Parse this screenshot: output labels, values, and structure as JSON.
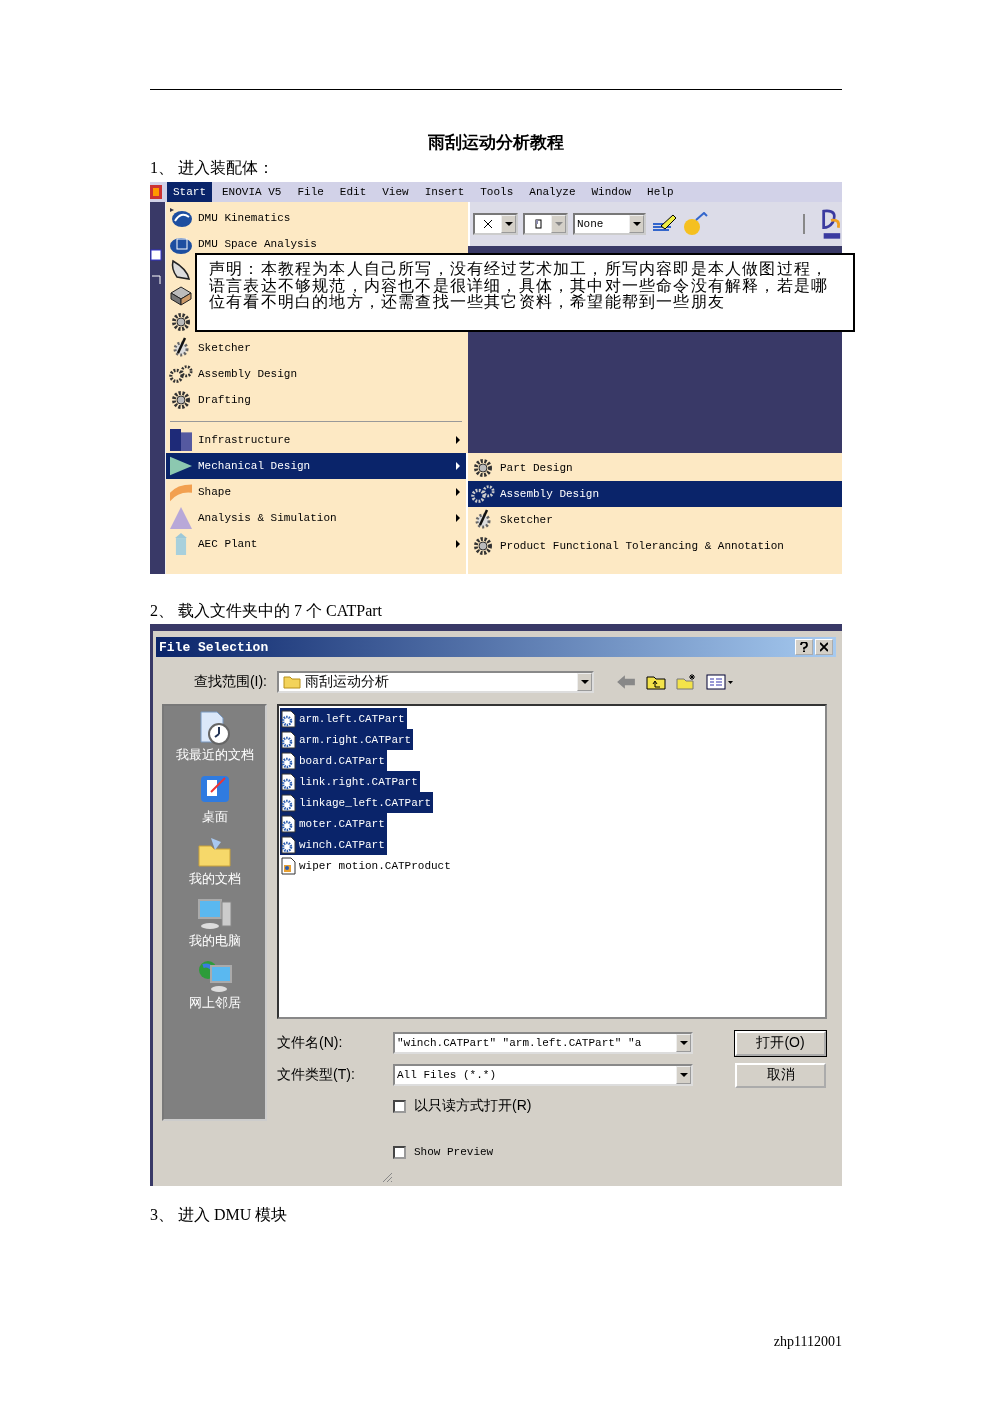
{
  "doc_title": "雨刮运动分析教程",
  "step_1": "1、 进入装配体：",
  "catia_screenshot": {
    "menu_bar": [
      {
        "label": "Start",
        "selected": true
      },
      {
        "label": "ENOVIA V5",
        "selected": false
      },
      {
        "label": "File",
        "selected": false
      },
      {
        "label": "Edit",
        "selected": false
      },
      {
        "label": "View",
        "selected": false
      },
      {
        "label": "Insert",
        "selected": false
      },
      {
        "label": "Tools",
        "selected": false
      },
      {
        "label": "Analyze",
        "selected": false
      },
      {
        "label": "Window",
        "selected": false
      },
      {
        "label": "Help",
        "selected": false
      }
    ],
    "toolbar": {
      "style_combo": "None"
    },
    "workbenches": [
      {
        "label": "DMU Kinematics",
        "selected": false
      },
      {
        "label": "DMU Space Analysis",
        "selected": false
      },
      {
        "selected": false
      },
      {
        "selected": false
      },
      {
        "selected": false
      },
      {
        "label": "Sketcher",
        "selected": false
      },
      {
        "label": "Assembly Design",
        "selected": false
      },
      {
        "label": "Drafting",
        "selected": false
      }
    ],
    "categories": [
      {
        "label": "Infrastructure",
        "selected": false,
        "submenu": true
      },
      {
        "label": "Mechanical Design",
        "selected": true,
        "submenu": true
      },
      {
        "label": "Shape",
        "selected": false,
        "submenu": true
      },
      {
        "label": "Analysis & Simulation",
        "selected": false,
        "submenu": true
      },
      {
        "label": "AEC Plant",
        "selected": false,
        "submenu": true
      }
    ],
    "submenu": [
      {
        "label": "Part Design",
        "selected": false
      },
      {
        "label": "Assembly Design",
        "selected": true
      },
      {
        "label": "Sketcher",
        "selected": false
      },
      {
        "label": "Product Functional Tolerancing & Annotation",
        "selected": false
      }
    ],
    "notice": "声明：本教程为本人自己所写，没有经过艺术加工，所写内容即是本人做图过程，语言表达不够规范，内容也不是很详细，具体，其中对一些命令没有解释，若是哪位有看不明白的地方，还需查找一些其它资料，希望能帮到一些朋友"
  },
  "step_2": "2、 载入文件夹中的 7 个 CATPart",
  "file_dialog": {
    "title": "File Selection",
    "look_in_label": "查找范围(I):",
    "look_in_value": "雨刮运动分析",
    "places": [
      "我最近的文档",
      "桌面",
      "我的文档",
      "我的电脑",
      "网上邻居"
    ],
    "files": [
      {
        "name": "arm.left.CATPart",
        "selected": true,
        "kind": "part"
      },
      {
        "name": "arm.right.CATPart",
        "selected": true,
        "kind": "part"
      },
      {
        "name": "board.CATPart",
        "selected": true,
        "kind": "part"
      },
      {
        "name": "link.right.CATPart",
        "selected": true,
        "kind": "part"
      },
      {
        "name": "linkage_left.CATPart",
        "selected": true,
        "kind": "part"
      },
      {
        "name": "moter.CATPart",
        "selected": true,
        "kind": "part"
      },
      {
        "name": "winch.CATPart",
        "selected": true,
        "kind": "part"
      },
      {
        "name": "wiper motion.CATProduct",
        "selected": false,
        "kind": "product"
      }
    ],
    "file_name_label": "文件名(N):",
    "file_name_value": "\"winch.CATPart\" \"arm.left.CATPart\" \"a",
    "file_type_label": "文件类型(T):",
    "file_type_value": "All Files (*.*)",
    "read_only": {
      "label": "以只读方式打开(R)",
      "checked": false
    },
    "show_preview": {
      "label": "Show Preview",
      "checked": false
    },
    "buttons": [
      "打开(O)",
      "取消"
    ]
  },
  "step_3": "3、 进入 DMU 模块",
  "footer": "zhp1112001"
}
